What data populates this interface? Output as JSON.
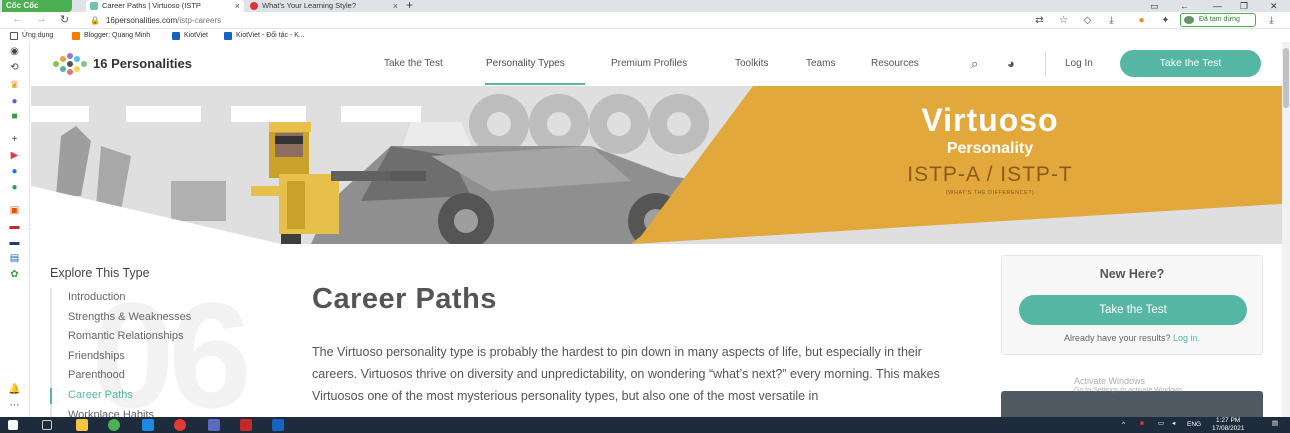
{
  "browser": {
    "brand": "Cốc Cốc",
    "tabs": [
      {
        "title": "Career Paths | Virtuoso (ISTP",
        "active": true
      },
      {
        "title": "What's Your Learning Style? ",
        "active": false
      }
    ],
    "url_host": "16personalities.com",
    "url_path": "/istp-careers",
    "paused_label": "Đã tạm dừng",
    "bookmarks": [
      "Ứng dụng",
      "Blogger: Quang Minh",
      "KiotViet",
      "KiotViet - Đối tác - K..."
    ]
  },
  "site": {
    "logo": "16 Personalities",
    "nav": [
      "Take the Test",
      "Personality Types",
      "Premium Profiles",
      "Toolkits",
      "Teams",
      "Resources"
    ],
    "login": "Log In",
    "cta": "Take the Test"
  },
  "hero": {
    "title": "Virtuoso",
    "subtitle": "Personality",
    "code": "ISTP-A / ISTP-T",
    "difference": "(WHAT'S THE DIFFERENCE?)"
  },
  "explore": {
    "heading": "Explore This Type",
    "big_number": "06",
    "items": [
      "Introduction",
      "Strengths & Weaknesses",
      "Romantic Relationships",
      "Friendships",
      "Parenthood",
      "Career Paths",
      "Workplace Habits"
    ],
    "current": "Career Paths"
  },
  "article": {
    "heading": "Career Paths",
    "paragraph": "The Virtuoso personality type is probably the hardest to pin down in many aspects of life, but especially in their careers. Virtuosos thrive on diversity and unpredictability, on wondering “what’s next?” every morning. This makes Virtuosos one of the most mysterious personality types, but also one of the most versatile in"
  },
  "new_here": {
    "heading": "New Here?",
    "button": "Take the Test",
    "text": "Already have your results?",
    "link": "Log in."
  },
  "watermark": {
    "line1": "Activate Windows",
    "line2": "Go to Settings to activate Windows."
  },
  "taskbar": {
    "lang": "ENG",
    "time": "1:27 PM",
    "date": "17/08/2021"
  },
  "colors": {
    "accent": "#56b6a4",
    "hero_gold": "#e3a83b",
    "hero_grey": "#dfdfe0"
  }
}
